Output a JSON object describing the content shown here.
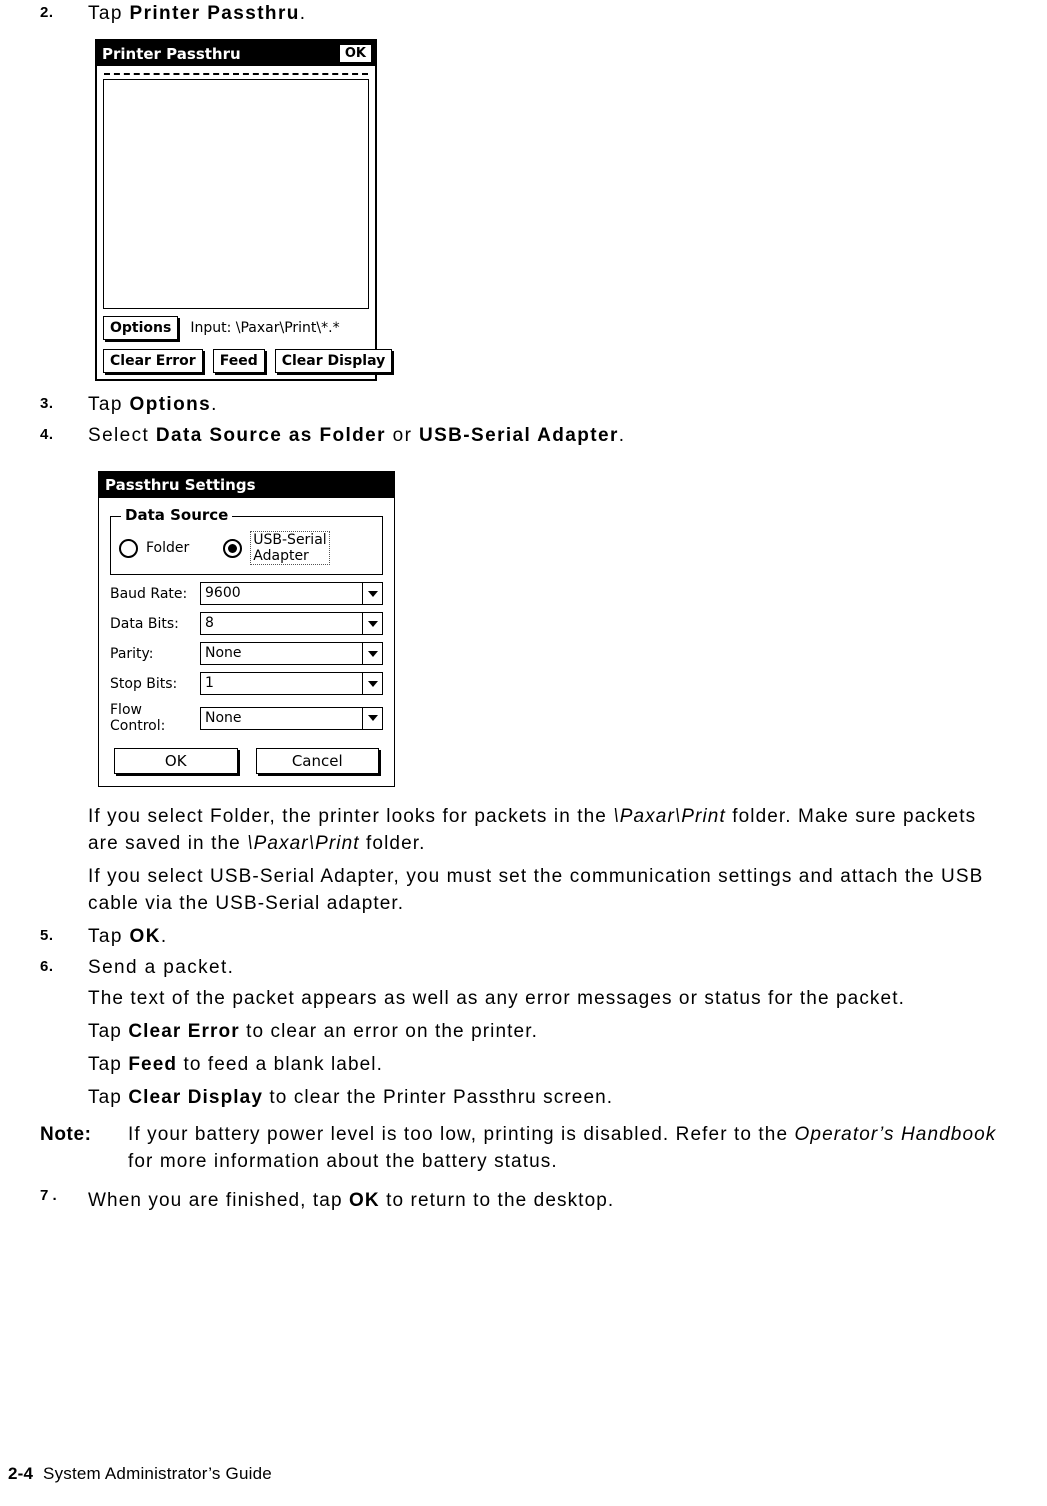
{
  "steps": {
    "s2": {
      "num": "2.",
      "pre": "Tap ",
      "bold": "Printer Passthru",
      "post": "."
    },
    "s3": {
      "num": "3.",
      "pre": "Tap ",
      "bold": "Options",
      "post": "."
    },
    "s4": {
      "num": "4.",
      "pre": "Select ",
      "bold1": "Data Source as Folder",
      "mid": " or ",
      "bold2": "USB-Serial Adapter",
      "post": "."
    },
    "s5": {
      "num": "5.",
      "pre": "Tap ",
      "bold": "OK",
      "post": "."
    },
    "s6": {
      "num": "6.",
      "text": "Send a packet."
    },
    "s7": {
      "num": "7 .",
      "pre": "When you are finished, tap ",
      "bold": "OK",
      "post": " to return to the desktop."
    }
  },
  "passthru_screen": {
    "title": "Printer Passthru",
    "ok_label": "OK",
    "options_label": "Options",
    "input_label": "Input: \\Paxar\\Print\\*.*",
    "clear_error_label": "Clear Error",
    "feed_label": "Feed",
    "clear_display_label": "Clear Display"
  },
  "settings_screen": {
    "title": "Passthru Settings",
    "group_title": "Data Source",
    "option_folder": "Folder",
    "option_usb_line1": "USB-Serial",
    "option_usb_line2": "Adapter",
    "selected": "USB-Serial Adapter",
    "fields": [
      {
        "label": "Baud Rate:",
        "value": "9600"
      },
      {
        "label": "Data Bits:",
        "value": "8"
      },
      {
        "label": "Parity:",
        "value": "None"
      },
      {
        "label": "Stop Bits:",
        "value": "1"
      }
    ],
    "flow_label_line1": "Flow",
    "flow_label_line2": "Control:",
    "flow_value": "None",
    "ok_label": "OK",
    "cancel_label": "Cancel"
  },
  "body": {
    "p_folder_1": "If you select Folder, the printer looks for packets in the ",
    "p_folder_i1": "\\Paxar\\Print",
    "p_folder_2": " folder. Make sure packets are saved in the ",
    "p_folder_i2": "\\Paxar\\Print",
    "p_folder_3": " folder.",
    "p_usb": "If you select USB-Serial Adapter, you must set the communication settings and attach the USB cable via the USB-Serial adapter.",
    "p_packet_text": "The text of the packet appears as well as any error messages or status for the packet.",
    "p_clear_error_pre": "Tap ",
    "p_clear_error_b": "Clear Error",
    "p_clear_error_post": " to clear an error on the printer.",
    "p_feed_pre": "Tap ",
    "p_feed_b": "Feed",
    "p_feed_post": " to feed a blank label.",
    "p_clear_display_pre": "Tap ",
    "p_clear_display_b": "Clear Display",
    "p_clear_display_post": " to clear the Printer Passthru screen."
  },
  "note": {
    "label": "Note:",
    "text1": "If your battery power level is too low, printing is disabled. Refer to the ",
    "italic": "Operator’s Handbook",
    "text2": " for more information about the battery status."
  },
  "footer": {
    "page": "2-4",
    "title": "System Administrator’s Guide"
  }
}
